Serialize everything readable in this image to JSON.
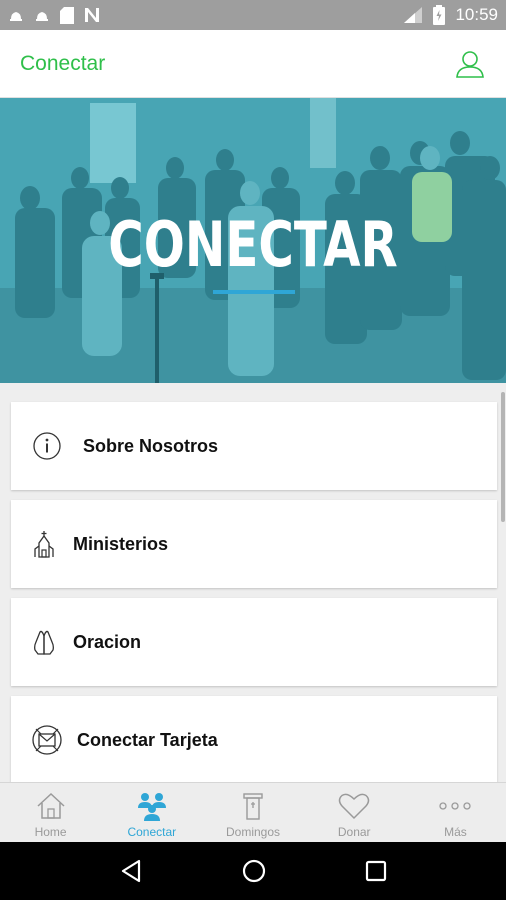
{
  "status_bar": {
    "time": "10:59"
  },
  "header": {
    "title": "Conectar",
    "profile_icon": "user-icon"
  },
  "hero": {
    "title": "CONECTAR"
  },
  "menu": {
    "items": [
      {
        "label": "Sobre Nosotros",
        "icon": "info-icon"
      },
      {
        "label": "Ministerios",
        "icon": "church-icon"
      },
      {
        "label": "Oracion",
        "icon": "praying-hands-icon"
      },
      {
        "label": "Conectar Tarjeta",
        "icon": "card-icon"
      }
    ]
  },
  "tabs": {
    "items": [
      {
        "label": "Home",
        "icon": "home-icon",
        "active": false
      },
      {
        "label": "Conectar",
        "icon": "people-icon",
        "active": true
      },
      {
        "label": "Domingos",
        "icon": "podium-icon",
        "active": false
      },
      {
        "label": "Donar",
        "icon": "heart-icon",
        "active": false
      },
      {
        "label": "Más",
        "icon": "more-icon",
        "active": false
      }
    ]
  },
  "colors": {
    "accent_green": "#2fbf4a",
    "accent_blue": "#2fa6d6",
    "hero_teal": "#3e97a6"
  }
}
